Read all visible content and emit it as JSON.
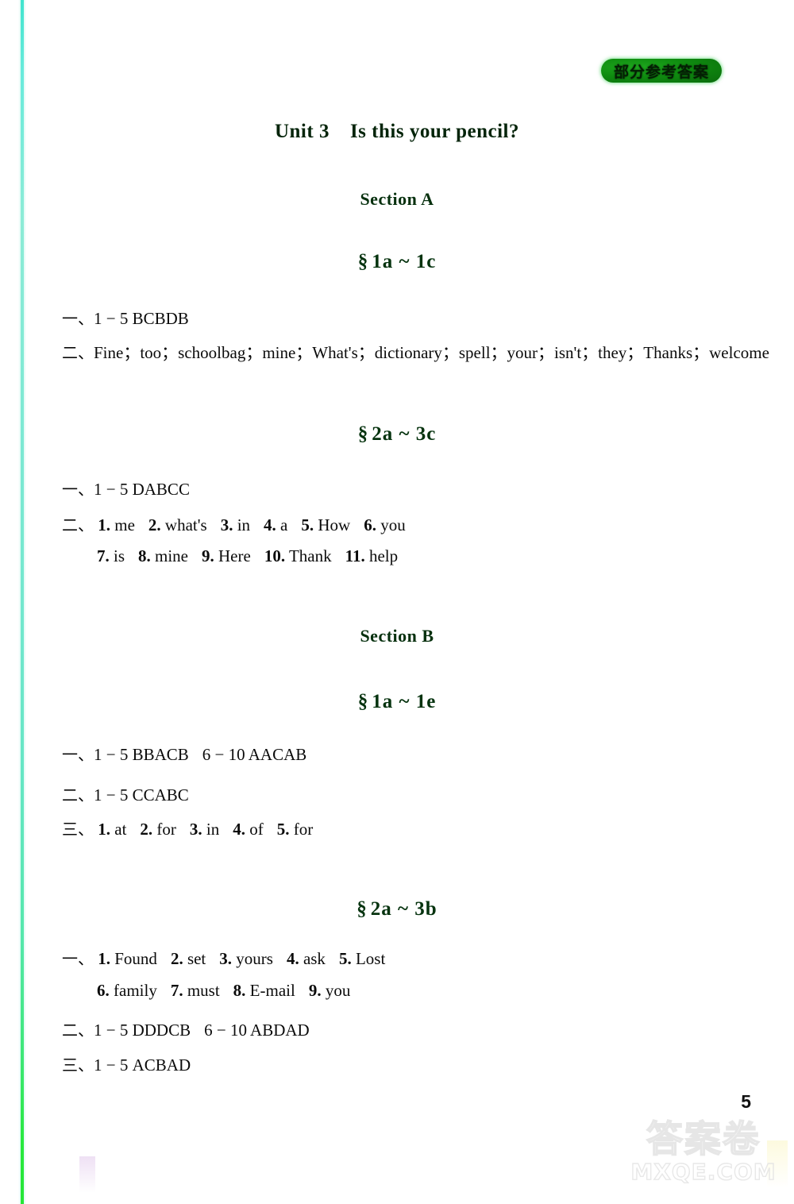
{
  "stamp": {
    "label": "部分参考答案"
  },
  "unit": {
    "number": "Unit 3",
    "title": "Is this your pencil?"
  },
  "sections": [
    {
      "label": "Section A"
    },
    {
      "label": "Section B"
    }
  ],
  "parts": [
    {
      "symbol": "§",
      "range": "1a ~ 1c"
    },
    {
      "symbol": "§",
      "range": "2a ~ 3c"
    },
    {
      "symbol": "§",
      "range": "1a ~ 1e"
    },
    {
      "symbol": "§",
      "range": "2a ~ 3b"
    }
  ],
  "answers": {
    "a1_one": {
      "marker": "一、",
      "text": "1 − 5 BCBDB"
    },
    "a1_two": {
      "marker": "二、",
      "text": "Fine；too；schoolbag；mine；What's；dictionary；spell；your；isn't；they；Thanks；welcome"
    },
    "a2_one": {
      "marker": "一、",
      "text": "1 − 5 DABCC"
    },
    "a2_two_marker": "二、",
    "a2_two_items": [
      {
        "num": "1.",
        "word": "me"
      },
      {
        "num": "2.",
        "word": "what's"
      },
      {
        "num": "3.",
        "word": "in"
      },
      {
        "num": "4.",
        "word": "a"
      },
      {
        "num": "5.",
        "word": "How"
      },
      {
        "num": "6.",
        "word": "you"
      }
    ],
    "a2_two_items_cont": [
      {
        "num": "7.",
        "word": "is"
      },
      {
        "num": "8.",
        "word": "mine"
      },
      {
        "num": "9.",
        "word": "Here"
      },
      {
        "num": "10.",
        "word": "Thank"
      },
      {
        "num": "11.",
        "word": "help"
      }
    ],
    "b1_one": {
      "marker": "一、",
      "text": "1 − 5 BBACB",
      "text2": "6 − 10 AACAB"
    },
    "b1_two": {
      "marker": "二、",
      "text": "1 − 5 CCABC"
    },
    "b1_three_marker": "三、",
    "b1_three_items": [
      {
        "num": "1.",
        "word": "at"
      },
      {
        "num": "2.",
        "word": "for"
      },
      {
        "num": "3.",
        "word": "in"
      },
      {
        "num": "4.",
        "word": "of"
      },
      {
        "num": "5.",
        "word": "for"
      }
    ],
    "b2_one_marker": "一、",
    "b2_one_items": [
      {
        "num": "1.",
        "word": "Found"
      },
      {
        "num": "2.",
        "word": "set"
      },
      {
        "num": "3.",
        "word": "yours"
      },
      {
        "num": "4.",
        "word": "ask"
      },
      {
        "num": "5.",
        "word": "Lost"
      }
    ],
    "b2_one_items_cont": [
      {
        "num": "6.",
        "word": "family"
      },
      {
        "num": "7.",
        "word": "must"
      },
      {
        "num": "8.",
        "word": "E-mail"
      },
      {
        "num": "9.",
        "word": "you"
      }
    ],
    "b2_two": {
      "marker": "二、",
      "text": "1 − 5 DDDCB",
      "text2": "6 − 10 ABDAD"
    },
    "b2_three": {
      "marker": "三、",
      "text": "1 − 5 ACBAD"
    }
  },
  "footer": {
    "page_number": "5",
    "watermark_cn": "答案卷",
    "watermark_en": "MXQE.COM"
  }
}
